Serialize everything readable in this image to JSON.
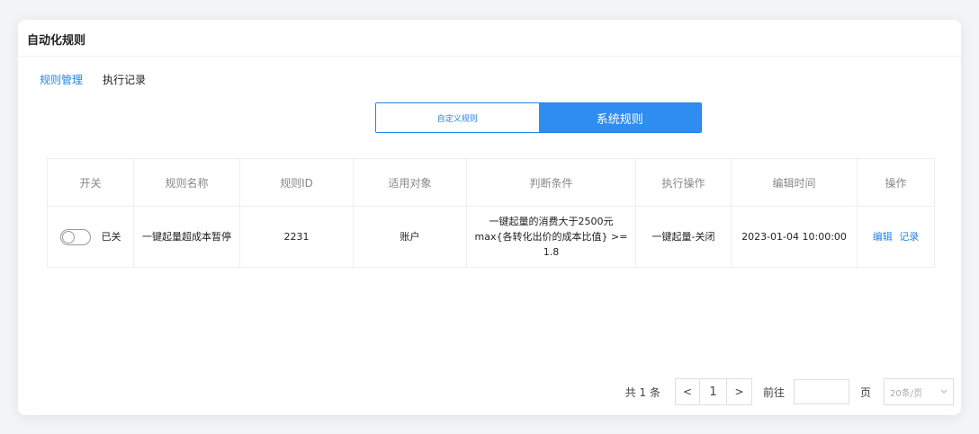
{
  "card": {
    "title": "自动化规则"
  },
  "tabs": [
    {
      "label": "规则管理"
    },
    {
      "label": "执行记录"
    }
  ],
  "segment": {
    "left": "自定义规则",
    "right": "系统规则"
  },
  "table": {
    "headers": [
      "开关",
      "规则名称",
      "规则ID",
      "适用对象",
      "判断条件",
      "执行操作",
      "编辑时间",
      "操作"
    ],
    "rows": [
      {
        "switch_label": "已关",
        "name": "一键起量超成本暂停",
        "id": "2231",
        "target": "账户",
        "condition_line1": "一键起量的消费大于2500元",
        "condition_line2": "max{各转化出价的成本比值} >= 1.8",
        "action": "一键起量-关闭",
        "time": "2023-01-04 10:00:00",
        "op_edit": "编辑",
        "op_log": "记录"
      }
    ]
  },
  "pagination": {
    "total": "共 1 条",
    "prev": "<",
    "page": "1",
    "next": ">",
    "goto": "前往",
    "page_unit": "页",
    "page_size": "20条/页"
  }
}
